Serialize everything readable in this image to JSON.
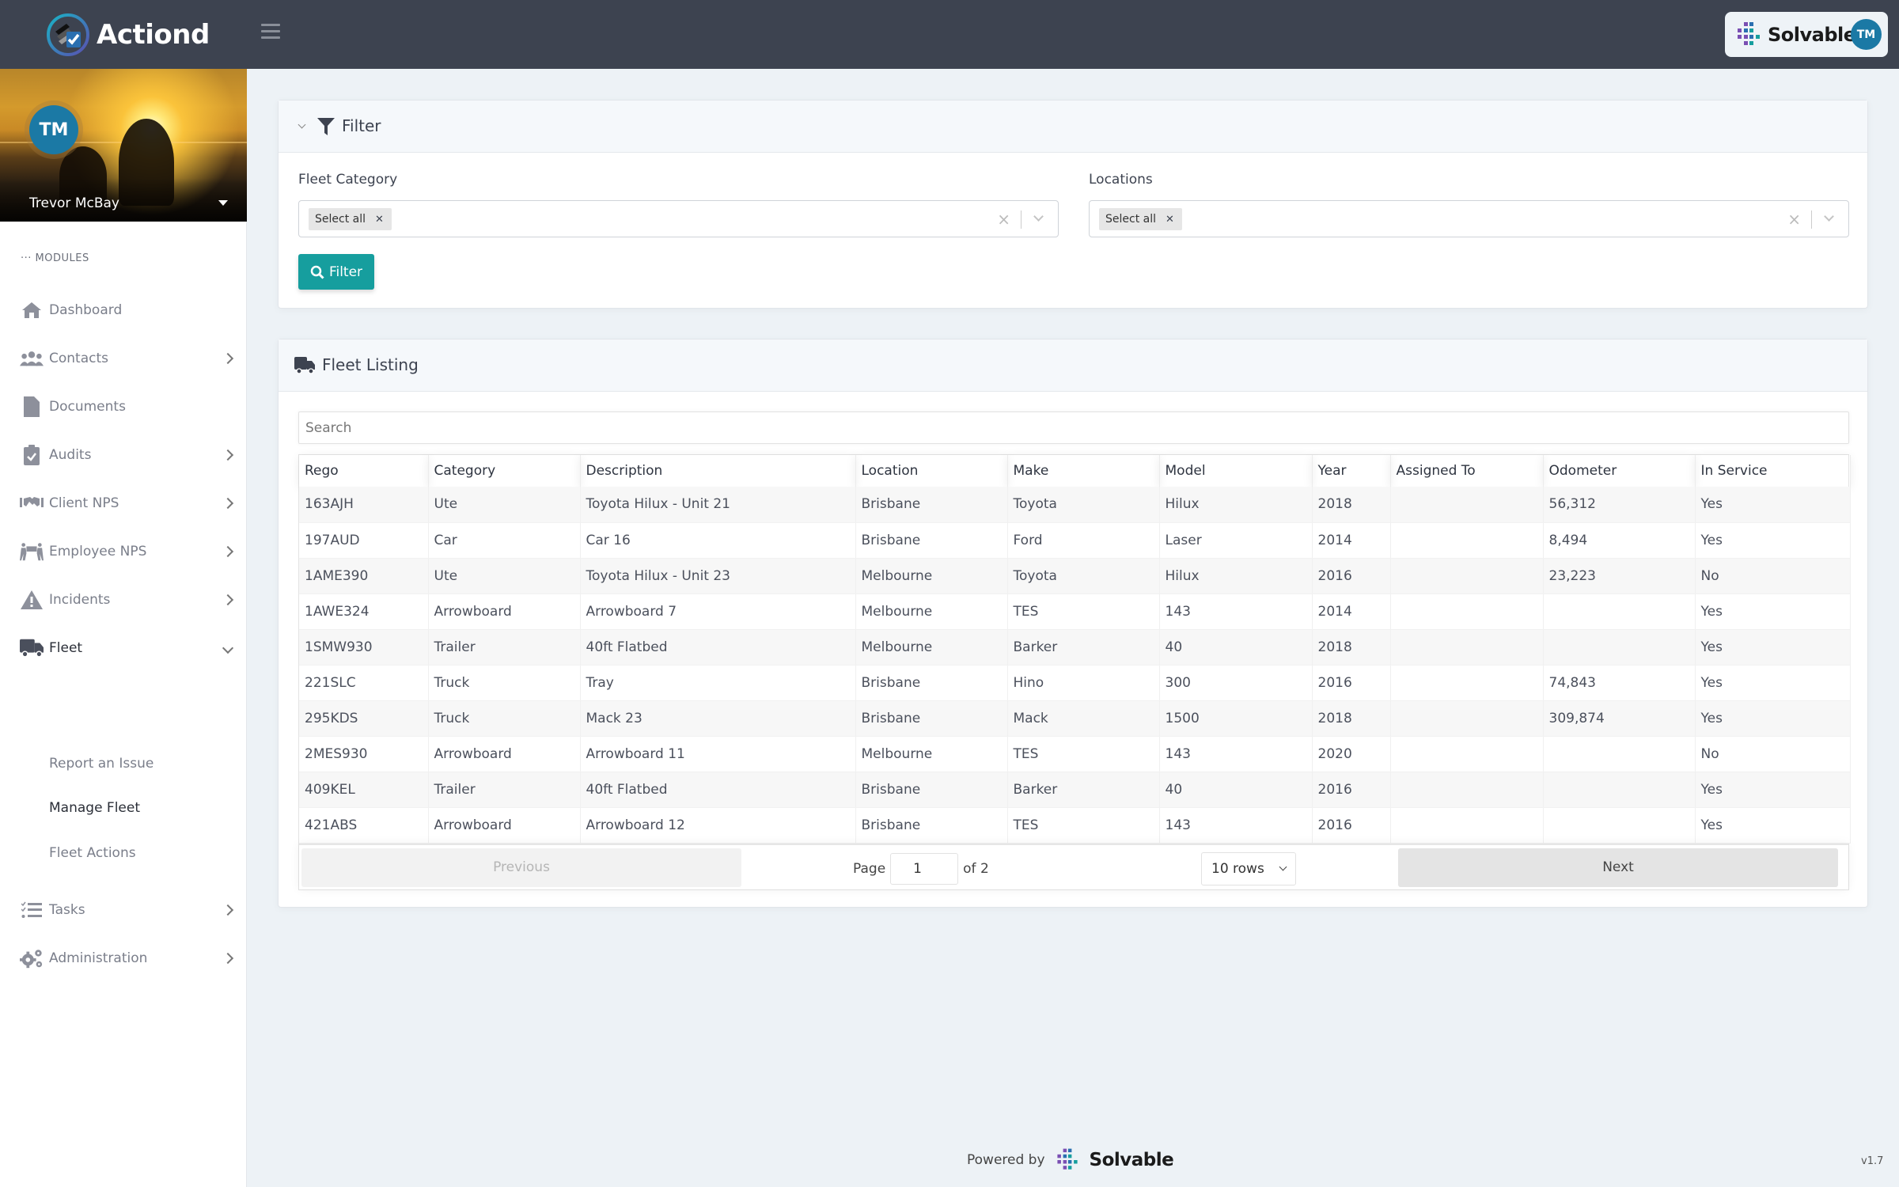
{
  "app": {
    "brand_name": "Actiond",
    "partner_brand": "Solvable",
    "user_initials": "TM"
  },
  "sidebar": {
    "user_name": "Trevor McBay",
    "user_initials": "TM",
    "section_label": "MODULES",
    "items": [
      {
        "label": "Dashboard",
        "icon": "home-icon",
        "has_children": false
      },
      {
        "label": "Contacts",
        "icon": "users-icon",
        "has_children": true
      },
      {
        "label": "Documents",
        "icon": "document-icon",
        "has_children": false
      },
      {
        "label": "Audits",
        "icon": "clipboard-check-icon",
        "has_children": true
      },
      {
        "label": "Client NPS",
        "icon": "handshake-icon",
        "has_children": true
      },
      {
        "label": "Employee NPS",
        "icon": "people-carry-icon",
        "has_children": true
      },
      {
        "label": "Incidents",
        "icon": "warning-icon",
        "has_children": true
      },
      {
        "label": "Fleet",
        "icon": "truck-icon",
        "has_children": true,
        "expanded": true,
        "active": true
      },
      {
        "label": "Tasks",
        "icon": "tasks-icon",
        "has_children": true
      },
      {
        "label": "Administration",
        "icon": "gears-icon",
        "has_children": true
      }
    ],
    "fleet_subitems": [
      {
        "label": "Report an Issue",
        "active": false
      },
      {
        "label": "Manage Fleet",
        "active": true
      },
      {
        "label": "Fleet Actions",
        "active": false
      }
    ]
  },
  "filter": {
    "title": "Filter",
    "fleet_category": {
      "label": "Fleet Category",
      "selected": [
        "Select all"
      ]
    },
    "locations": {
      "label": "Locations",
      "selected": [
        "Select all"
      ]
    },
    "button_label": "Filter"
  },
  "listing": {
    "title": "Fleet Listing",
    "search_placeholder": "Search",
    "columns": [
      "Rego",
      "Category",
      "Description",
      "Location",
      "Make",
      "Model",
      "Year",
      "Assigned To",
      "Odometer",
      "In Service"
    ],
    "rows": [
      [
        "163AJH",
        "Ute",
        "Toyota Hilux - Unit 21",
        "Brisbane",
        "Toyota",
        "Hilux",
        "2018",
        "",
        "56,312",
        "Yes"
      ],
      [
        "197AUD",
        "Car",
        "Car 16",
        "Brisbane",
        "Ford",
        "Laser",
        "2014",
        "",
        "8,494",
        "Yes"
      ],
      [
        "1AME390",
        "Ute",
        "Toyota Hilux - Unit 23",
        "Melbourne",
        "Toyota",
        "Hilux",
        "2016",
        "",
        "23,223",
        "No"
      ],
      [
        "1AWE324",
        "Arrowboard",
        "Arrowboard 7",
        "Melbourne",
        "TES",
        "143",
        "2014",
        "",
        "",
        "Yes"
      ],
      [
        "1SMW930",
        "Trailer",
        "40ft Flatbed",
        "Melbourne",
        "Barker",
        "40",
        "2018",
        "",
        "",
        "Yes"
      ],
      [
        "221SLC",
        "Truck",
        "Tray",
        "Brisbane",
        "Hino",
        "300",
        "2016",
        "",
        "74,843",
        "Yes"
      ],
      [
        "295KDS",
        "Truck",
        "Mack 23",
        "Brisbane",
        "Mack",
        "1500",
        "2018",
        "",
        "309,874",
        "Yes"
      ],
      [
        "2MES930",
        "Arrowboard",
        "Arrowboard 11",
        "Melbourne",
        "TES",
        "143",
        "2020",
        "",
        "",
        "No"
      ],
      [
        "409KEL",
        "Trailer",
        "40ft Flatbed",
        "Brisbane",
        "Barker",
        "40",
        "2016",
        "",
        "",
        "Yes"
      ],
      [
        "421ABS",
        "Arrowboard",
        "Arrowboard 12",
        "Brisbane",
        "TES",
        "143",
        "2016",
        "",
        "",
        "Yes"
      ]
    ],
    "pagination": {
      "previous_label": "Previous",
      "next_label": "Next",
      "page_label": "Page",
      "current_page": "1",
      "of_label": "of 2",
      "rows_option": "10 rows"
    }
  },
  "footer": {
    "powered_by": "Powered by",
    "brand": "Solvable",
    "version": "v1.7"
  },
  "colors": {
    "header_bg": "#3d4350",
    "accent_teal": "#169e9e",
    "avatar_blue": "#1b79a5",
    "content_bg": "#edf2f6"
  }
}
